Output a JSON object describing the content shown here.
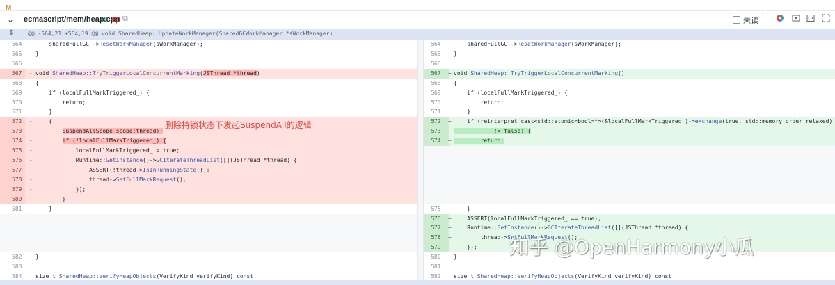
{
  "top_mark": "M",
  "file_header": {
    "chevron": "⌄",
    "path": "ecmascript/mem/heap.cpp",
    "additions": "+8",
    "deletions": "-10",
    "copy_icon": "⧉",
    "unread_label": "未读"
  },
  "hunk": {
    "expand_icon": "⇕",
    "text": "@@ -564,21 +564,19 @@ void SharedHeap::UpdateWorkManager(SharedGCWorkManager *sWorkManager)"
  },
  "left_lines": [
    {
      "ln": "564",
      "sign": "",
      "type": "ctx",
      "code": "    sharedFullGC_->ResetWorkManager(sWorkManager);"
    },
    {
      "ln": "565",
      "sign": "",
      "type": "ctx",
      "code": "}"
    },
    {
      "ln": "566",
      "sign": "",
      "type": "ctx",
      "code": ""
    },
    {
      "ln": "567",
      "sign": "-",
      "type": "del",
      "code": "void SharedHeap::TryTriggerLocalConcurrentMarking(JSThread *thread)"
    },
    {
      "ln": "568",
      "sign": "",
      "type": "ctx",
      "code": "{"
    },
    {
      "ln": "569",
      "sign": "",
      "type": "ctx",
      "code": "    if (localFullMarkTriggered_) {"
    },
    {
      "ln": "570",
      "sign": "",
      "type": "ctx",
      "code": "        return;"
    },
    {
      "ln": "571",
      "sign": "",
      "type": "ctx",
      "code": "    }"
    },
    {
      "ln": "572",
      "sign": "-",
      "type": "del",
      "code": "    {"
    },
    {
      "ln": "573",
      "sign": "-",
      "type": "del",
      "code": "        SuspendAllScope scope(thread);"
    },
    {
      "ln": "574",
      "sign": "-",
      "type": "del",
      "code": "        if (!localFullMarkTriggered_) {"
    },
    {
      "ln": "575",
      "sign": "-",
      "type": "del",
      "code": "            localFullMarkTriggered_ = true;"
    },
    {
      "ln": "576",
      "sign": "-",
      "type": "del",
      "code": "            Runtime::GetInstance()->GCIterateThreadList([](JSThread *thread) {"
    },
    {
      "ln": "577",
      "sign": "-",
      "type": "del",
      "code": "                ASSERT(!thread->IsInRunningState());"
    },
    {
      "ln": "578",
      "sign": "-",
      "type": "del",
      "code": "                thread->SetFullMarkRequest();"
    },
    {
      "ln": "579",
      "sign": "-",
      "type": "del",
      "code": "            });"
    },
    {
      "ln": "580",
      "sign": "-",
      "type": "del",
      "code": "        }"
    },
    {
      "ln": "581",
      "sign": "",
      "type": "ctx",
      "code": "    }"
    },
    {
      "ln": "",
      "sign": "",
      "type": "filler",
      "code": ""
    },
    {
      "ln": "",
      "sign": "",
      "type": "filler",
      "code": ""
    },
    {
      "ln": "",
      "sign": "",
      "type": "filler",
      "code": ""
    },
    {
      "ln": "",
      "sign": "",
      "type": "filler",
      "code": ""
    },
    {
      "ln": "582",
      "sign": "",
      "type": "ctx",
      "code": "}"
    },
    {
      "ln": "583",
      "sign": "",
      "type": "ctx",
      "code": ""
    },
    {
      "ln": "584",
      "sign": "",
      "type": "ctx",
      "code": "size_t SharedHeap::VerifyHeapObjects(VerifyKind verifyKind) const"
    }
  ],
  "right_lines": [
    {
      "ln": "564",
      "sign": "",
      "type": "ctx",
      "code": "    sharedFullGC_->ResetWorkManager(sWorkManager);"
    },
    {
      "ln": "565",
      "sign": "",
      "type": "ctx",
      "code": "}"
    },
    {
      "ln": "566",
      "sign": "",
      "type": "ctx",
      "code": ""
    },
    {
      "ln": "567",
      "sign": "+",
      "type": "add",
      "code": "void SharedHeap::TryTriggerLocalConcurrentMarking()"
    },
    {
      "ln": "568",
      "sign": "",
      "type": "ctx",
      "code": "{"
    },
    {
      "ln": "569",
      "sign": "",
      "type": "ctx",
      "code": "    if (localFullMarkTriggered_) {"
    },
    {
      "ln": "570",
      "sign": "",
      "type": "ctx",
      "code": "        return;"
    },
    {
      "ln": "571",
      "sign": "",
      "type": "ctx",
      "code": "    }"
    },
    {
      "ln": "572",
      "sign": "+",
      "type": "add",
      "code": "    if (reinterpret_cast<std::atomic<bool>*>(&localFullMarkTriggered_)->exchange(true, std::memory_order_relaxed)"
    },
    {
      "ln": "573",
      "sign": "+",
      "type": "add",
      "code": "            != false) {"
    },
    {
      "ln": "574",
      "sign": "+",
      "type": "add",
      "code": "        return;"
    },
    {
      "ln": "",
      "sign": "",
      "type": "filler",
      "code": ""
    },
    {
      "ln": "",
      "sign": "",
      "type": "filler",
      "code": ""
    },
    {
      "ln": "",
      "sign": "",
      "type": "filler",
      "code": ""
    },
    {
      "ln": "",
      "sign": "",
      "type": "filler",
      "code": ""
    },
    {
      "ln": "",
      "sign": "",
      "type": "filler",
      "code": ""
    },
    {
      "ln": "",
      "sign": "",
      "type": "filler",
      "code": ""
    },
    {
      "ln": "575",
      "sign": "",
      "type": "ctx",
      "code": "    }"
    },
    {
      "ln": "576",
      "sign": "+",
      "type": "add",
      "code": "    ASSERT(localFullMarkTriggered_ == true);"
    },
    {
      "ln": "577",
      "sign": "+",
      "type": "add",
      "code": "    Runtime::GetInstance()->GCIterateThreadList([](JSThread *thread) {"
    },
    {
      "ln": "578",
      "sign": "+",
      "type": "add",
      "code": "        thread->SetFullMarkRequest();"
    },
    {
      "ln": "579",
      "sign": "+",
      "type": "add",
      "code": "    });"
    },
    {
      "ln": "580",
      "sign": "",
      "type": "ctx",
      "code": "}"
    },
    {
      "ln": "581",
      "sign": "",
      "type": "ctx",
      "code": ""
    },
    {
      "ln": "582",
      "sign": "",
      "type": "ctx",
      "code": "size_t SharedHeap::VerifyHeapObjects(VerifyKind verifyKind) const"
    }
  ],
  "annotation": "删除持锁状态下发起SuspendAll的逻辑",
  "watermark": "知乎 @OpenHarmony小瓜",
  "toolbar_icons": [
    "palette-icon",
    "preview-icon",
    "code-view-icon",
    "expand-icon",
    "more-icon"
  ],
  "colors": {
    "deleted_bg": "#ffe2e0",
    "added_bg": "#e5f7e8",
    "hunk_bg": "#dce3f3",
    "annotation": "#e8423a",
    "function_name": "#3b58a8"
  }
}
